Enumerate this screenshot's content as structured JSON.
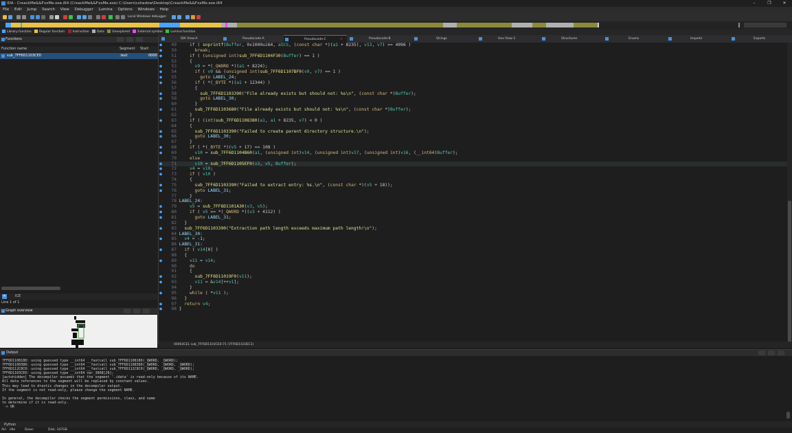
{
  "window": {
    "title": "IDA - CreackMe&&FxxMe.exe.i64 (CreackMe&&FxxMe.exe) C:\\Users\\cshadow\\Desktop\\CreackMe&&FxxMe.exe.i64",
    "minimize": "–",
    "maximize": "❐",
    "close": "✕"
  },
  "menu": [
    "File",
    "Edit",
    "Jump",
    "Search",
    "View",
    "Debugger",
    "Lumina",
    "Options",
    "Windows",
    "Help"
  ],
  "toolbar": {
    "debugger_label": "Local Windows debugger"
  },
  "legend": [
    {
      "label": "Library function",
      "color": "#4aa3ff"
    },
    {
      "label": "Regular function",
      "color": "#e8c34a"
    },
    {
      "label": "Instruction",
      "color": "#8b2a2a"
    },
    {
      "label": "Data",
      "color": "#b0b0b0"
    },
    {
      "label": "Unexplored",
      "color": "#8a8a3a"
    },
    {
      "label": "External symbol",
      "color": "#ff40ff"
    },
    {
      "label": "Lumina function",
      "color": "#40c040"
    }
  ],
  "functions_pane": {
    "title": "Functions",
    "col_name": "Function name",
    "col_segment": "Segment",
    "col_start": "Start",
    "rows": [
      {
        "name": "sub_7FF6D1103CE0",
        "segment": ".text",
        "start": "0000"
      }
    ],
    "search_label": "ICE",
    "line_info": "Line 1 of 1"
  },
  "graph_overview": {
    "title": "Graph overview"
  },
  "tabs": [
    {
      "label": "IDA View-A"
    },
    {
      "label": "Pseudocode-A"
    },
    {
      "label": "Pseudocode-C"
    },
    {
      "label": "Pseudocode-B"
    },
    {
      "label": "Strings"
    },
    {
      "label": "Hex View-1"
    },
    {
      "label": "Structures"
    },
    {
      "label": "Enums"
    },
    {
      "label": "Imports"
    },
    {
      "label": "Exports"
    }
  ],
  "code_lines": [
    {
      "n": "49",
      "dot": true,
      "text": "    if ( snprintf(Buffer, 0x1000ui64, aSCS, (const char *)(a1 + 8235), v13, v7) >= 4096 )"
    },
    {
      "n": "50",
      "dot": true,
      "text": "      break;"
    },
    {
      "n": "51",
      "dot": true,
      "text": "    if ( (unsigned int)sub_7FF6D1104F30(Buffer) == 1 )"
    },
    {
      "n": "52",
      "dot": false,
      "text": "    {"
    },
    {
      "n": "53",
      "dot": true,
      "text": "      v9 = *(_QWORD *)(a1 + 8224);"
    },
    {
      "n": "54",
      "dot": true,
      "text": "      if ( v9 && (unsigned int)sub_7FF6D1107BF0(v9, v7) == 1 )"
    },
    {
      "n": "55",
      "dot": true,
      "text": "        goto LABEL_24;"
    },
    {
      "n": "56",
      "dot": true,
      "text": "      if ( *(_BYTE *)(a1 + 12344) )"
    },
    {
      "n": "57",
      "dot": false,
      "text": "      {"
    },
    {
      "n": "58",
      "dot": true,
      "text": "        sub_7FF6D1103390(\"File already exists but should not: %s\\n\", (const char *)Buffer);"
    },
    {
      "n": "59",
      "dot": true,
      "text": "        goto LABEL_30;"
    },
    {
      "n": "60",
      "dot": false,
      "text": "      }"
    },
    {
      "n": "61",
      "dot": true,
      "text": "      sub_7FF6D1103680(\"File already exists but should not: %s\\n\", (const char *)Buffer);"
    },
    {
      "n": "62",
      "dot": false,
      "text": "    }"
    },
    {
      "n": "63",
      "dot": true,
      "text": "    if ( (int)sub_7FF6D1108380(a1, a1 + 8235, v7) < 0 )"
    },
    {
      "n": "64",
      "dot": false,
      "text": "    {"
    },
    {
      "n": "65",
      "dot": true,
      "text": "      sub_7FF6D1103390(\"Failed to create parent directory structure.\\n\");"
    },
    {
      "n": "66",
      "dot": true,
      "text": "      goto LABEL_30;"
    },
    {
      "n": "67",
      "dot": false,
      "text": "    }"
    },
    {
      "n": "68",
      "dot": true,
      "text": "    if ( *(_BYTE *)(v5 + 17) == 108 )"
    },
    {
      "n": "69",
      "dot": true,
      "text": "      v10 = sub_7FF6D1104B60(a1, (unsigned int)v14, (unsigned int)v17, (unsigned int)v16, (__int64)Buffer);"
    },
    {
      "n": "70",
      "dot": false,
      "text": "    else"
    },
    {
      "n": "71",
      "dot": true,
      "text": "      v10 = sub_7FF6D1105EF0(v3, v5, Buffer);",
      "hl": true
    },
    {
      "n": "72",
      "dot": true,
      "text": "    v4 = v10;"
    },
    {
      "n": "73",
      "dot": true,
      "text": "    if ( v10 )"
    },
    {
      "n": "74",
      "dot": false,
      "text": "    {"
    },
    {
      "n": "75",
      "dot": true,
      "text": "      sub_7FF6D1103390(\"Failed to extract entry: %s.\\n\", (const char *)(v5 + 18));"
    },
    {
      "n": "76",
      "dot": true,
      "text": "      goto LABEL_31;"
    },
    {
      "n": "77",
      "dot": false,
      "text": "    }"
    },
    {
      "n": "78",
      "dot": false,
      "text": "LABEL_24:"
    },
    {
      "n": "79",
      "dot": true,
      "text": "    v5 = sub_7FF6D1101A30(v3, v5);"
    },
    {
      "n": "80",
      "dot": true,
      "text": "    if ( v5 >= *(_QWORD *)(v3 + 4112) )"
    },
    {
      "n": "81",
      "dot": true,
      "text": "      goto LABEL_31;"
    },
    {
      "n": "82",
      "dot": false,
      "text": "  }"
    },
    {
      "n": "83",
      "dot": true,
      "text": "  sub_7FF6D1103390(\"Extraction path length exceeds maximum path length!\\n\");"
    },
    {
      "n": "84",
      "dot": false,
      "text": "LABEL_30:"
    },
    {
      "n": "85",
      "dot": true,
      "text": "  v4 = -1;"
    },
    {
      "n": "86",
      "dot": false,
      "text": "LABEL_31:"
    },
    {
      "n": "87",
      "dot": true,
      "text": "  if ( v14[0] )"
    },
    {
      "n": "88",
      "dot": false,
      "text": "  {"
    },
    {
      "n": "89",
      "dot": true,
      "text": "    v11 = v14;"
    },
    {
      "n": "90",
      "dot": false,
      "text": "    do"
    },
    {
      "n": "91",
      "dot": false,
      "text": "    {"
    },
    {
      "n": "92",
      "dot": true,
      "text": "      sub_7FF6D11019F0(v11);"
    },
    {
      "n": "93",
      "dot": true,
      "text": "      v11 = &v14[++v1];"
    },
    {
      "n": "94",
      "dot": false,
      "text": "    }"
    },
    {
      "n": "95",
      "dot": true,
      "text": "    while ( *v11 );"
    },
    {
      "n": "96",
      "dot": false,
      "text": "  }"
    },
    {
      "n": "97",
      "dot": true,
      "text": "  return v4;"
    },
    {
      "n": "98",
      "dot": true,
      "text": "}"
    }
  ],
  "code_status": "00003CE1 sub_7FF6D1103CE0:71 (7FF6D1103EC1)",
  "output": {
    "title": "Output",
    "lines": [
      "7FF6D1108180: using guessed type __int64 __fastcall sub_7FF6D1108180(_QWORD, _QWORD);",
      "7FF6D1108380: using guessed type __int64 __fastcall sub_7FF6D1108380(_QWORD, _QWORD, _QWORD);",
      "7FF6D112C8C0: using guessed type __int64 __fastcall sub_7FF6D112C8C0(_QWORD, _QWORD, _QWORD);",
      "7FF6D1103CE0: using guessed type __int64 var_3808[28];",
      "[autohidden] The decompiler assumes that the segment '.idata' is read-only because of its NAME.",
      "All data references to the segment will be replaced by constant values.",
      "This may lead to drastic changes in the decompiler output.",
      "If the segment is not read-only, please change the segment NAME.",
      "",
      "In general, the decompiler checks the segment permissions, class, and name",
      "to determine if it is read-only.",
      " -> OK"
    ],
    "python_tab": "Python"
  },
  "statusbar": {
    "au": "AU:",
    "state": "idle",
    "dir": "Down",
    "disk": "Disk: 347GB"
  }
}
